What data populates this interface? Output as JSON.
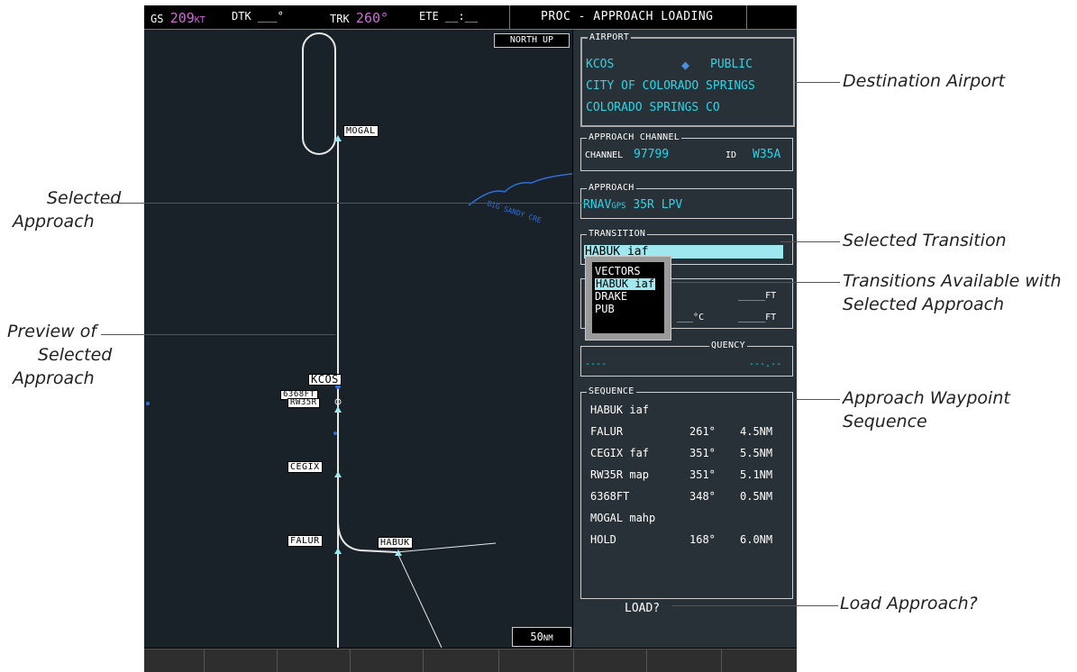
{
  "topbar": {
    "gs_label": "GS",
    "gs_value": "209",
    "gs_unit": "KT",
    "dtk_label": "DTK",
    "dtk_value": "___°",
    "trk_label": "TRK",
    "trk_value": "260°",
    "ete_label": "ETE",
    "ete_value": "__:__",
    "page_title": "PROC - APPROACH LOADING"
  },
  "map": {
    "north_up": "NORTH UP",
    "scale_value": "50",
    "scale_unit": "NM",
    "waypoints": {
      "mogal": "MOGAL",
      "kcos": "KCOS",
      "rwy_a": "6368FT",
      "rwy_b": "RW35R",
      "cegix": "CEGIX",
      "falur": "FALUR",
      "habuk": "HABUK"
    },
    "river_label": "BIG SANDY CRE"
  },
  "airport": {
    "title": "AIRPORT",
    "ident": "KCOS",
    "type": "PUBLIC",
    "name": "CITY OF COLORADO SPRINGS",
    "city": "COLORADO SPRINGS CO"
  },
  "approach_channel": {
    "title": "APPROACH CHANNEL",
    "channel_label": "CHANNEL",
    "channel_value": "97799",
    "id_label": "ID",
    "id_value": "W35A"
  },
  "approach": {
    "title": "APPROACH",
    "value_a": "RNAV",
    "value_b": "GPS",
    "value_c": " 35R LPV"
  },
  "transition": {
    "title": "TRANSITION",
    "value": "HABUK iaf"
  },
  "minimums": {
    "ft1": "_____FT",
    "temp": "___°C",
    "ft2": "_____FT"
  },
  "frequency": {
    "title_visible": "QUENCY",
    "left": "----",
    "right": "---.--"
  },
  "transition_options": [
    "VECTORS",
    "HABUK iaf",
    "DRAKE",
    "PUB"
  ],
  "sequence": {
    "title": "SEQUENCE",
    "rows": [
      {
        "name": "HABUK iaf",
        "dtk": "",
        "dist": ""
      },
      {
        "name": "FALUR",
        "dtk": "261°",
        "dist": "4.5NM"
      },
      {
        "name": "CEGIX faf",
        "dtk": "351°",
        "dist": "5.5NM"
      },
      {
        "name": "RW35R map",
        "dtk": "351°",
        "dist": "5.1NM"
      },
      {
        "name": "6368FT",
        "dtk": "348°",
        "dist": "0.5NM"
      },
      {
        "name": "MOGAL mahp",
        "dtk": "",
        "dist": ""
      },
      {
        "name": "HOLD",
        "dtk": "168°",
        "dist": "6.0NM"
      }
    ]
  },
  "load_prompt": "LOAD?",
  "callouts": {
    "destination_airport": "Destination Airport",
    "selected_approach_1": "Selected",
    "selected_approach_2": "Approach",
    "selected_transition": "Selected Transition",
    "transitions_available_1": "Transitions Available with",
    "transitions_available_2": "Selected Approach",
    "preview_1": "Preview of",
    "preview_2": "Selected",
    "preview_3": "Approach",
    "waypoint_seq_1": "Approach Waypoint",
    "waypoint_seq_2": "Sequence",
    "load_approach": "Load Approach?"
  },
  "colors": {
    "magenta": "#d16bd6",
    "cyan": "#29d6e6",
    "panel_bg": "#283038",
    "map_bg": "#1a2229",
    "selection": "#9fe8ef"
  }
}
